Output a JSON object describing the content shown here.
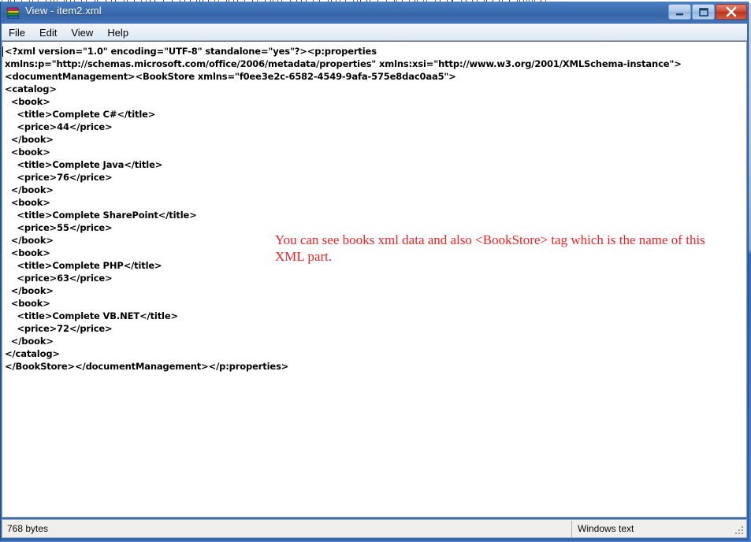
{
  "window": {
    "title": "View - item2.xml",
    "icon": "winrar-books-icon",
    "controls": {
      "minimize_label": "Minimize",
      "maximize_label": "Maximize",
      "close_label": "Close"
    }
  },
  "menubar": {
    "items": [
      {
        "label": "File",
        "name": "menu-file"
      },
      {
        "label": "Edit",
        "name": "menu-edit"
      },
      {
        "label": "View",
        "name": "menu-view"
      },
      {
        "label": "Help",
        "name": "menu-help"
      }
    ]
  },
  "editor": {
    "content": "<?xml version=\"1.0\" encoding=\"UTF-8\" standalone=\"yes\"?><p:properties\nxmlns:p=\"http://schemas.microsoft.com/office/2006/metadata/properties\" xmlns:xsi=\"http://www.w3.org/2001/XMLSchema-instance\">\n<documentManagement><BookStore xmlns=\"f0ee3e2c-6582-4549-9afa-575e8dac0aa5\">\n<catalog>\n  <book>\n    <title>Complete C#</title>\n    <price>44</price>\n  </book>\n  <book>\n    <title>Complete Java</title>\n    <price>76</price>\n  </book>\n  <book>\n    <title>Complete SharePoint</title>\n    <price>55</price>\n  </book>\n  <book>\n    <title>Complete PHP</title>\n    <price>63</price>\n  </book>\n  <book>\n    <title>Complete VB.NET</title>\n    <price>72</price>\n  </book>\n</catalog>\n</BookStore></documentManagement></p:properties>",
    "xml_declaration": "<?xml version=\"1.0\" encoding=\"UTF-8\" standalone=\"yes\"?>",
    "root_element": "p:properties",
    "namespaces": {
      "p": "http://schemas.microsoft.com/office/2006/metadata/properties",
      "xsi": "http://www.w3.org/2001/XMLSchema-instance",
      "bookstore": "f0ee3e2c-6582-4549-9afa-575e8dac0aa5"
    },
    "catalog": [
      {
        "title": "Complete C#",
        "price": "44"
      },
      {
        "title": "Complete Java",
        "price": "76"
      },
      {
        "title": "Complete SharePoint",
        "price": "55"
      },
      {
        "title": "Complete PHP",
        "price": "63"
      },
      {
        "title": "Complete VB.NET",
        "price": "72"
      }
    ]
  },
  "annotation": {
    "text": "You can see books xml data and also <BookStore> tag which is the name of this XML part.",
    "color": "#ee2222"
  },
  "statusbar": {
    "size": "768 bytes",
    "encoding": "Windows text"
  },
  "colors": {
    "titlebar": "#3c6fb2",
    "close_button": "#cf4f37",
    "desktop": "#3c74c4",
    "annotation": "#ee2222"
  }
}
